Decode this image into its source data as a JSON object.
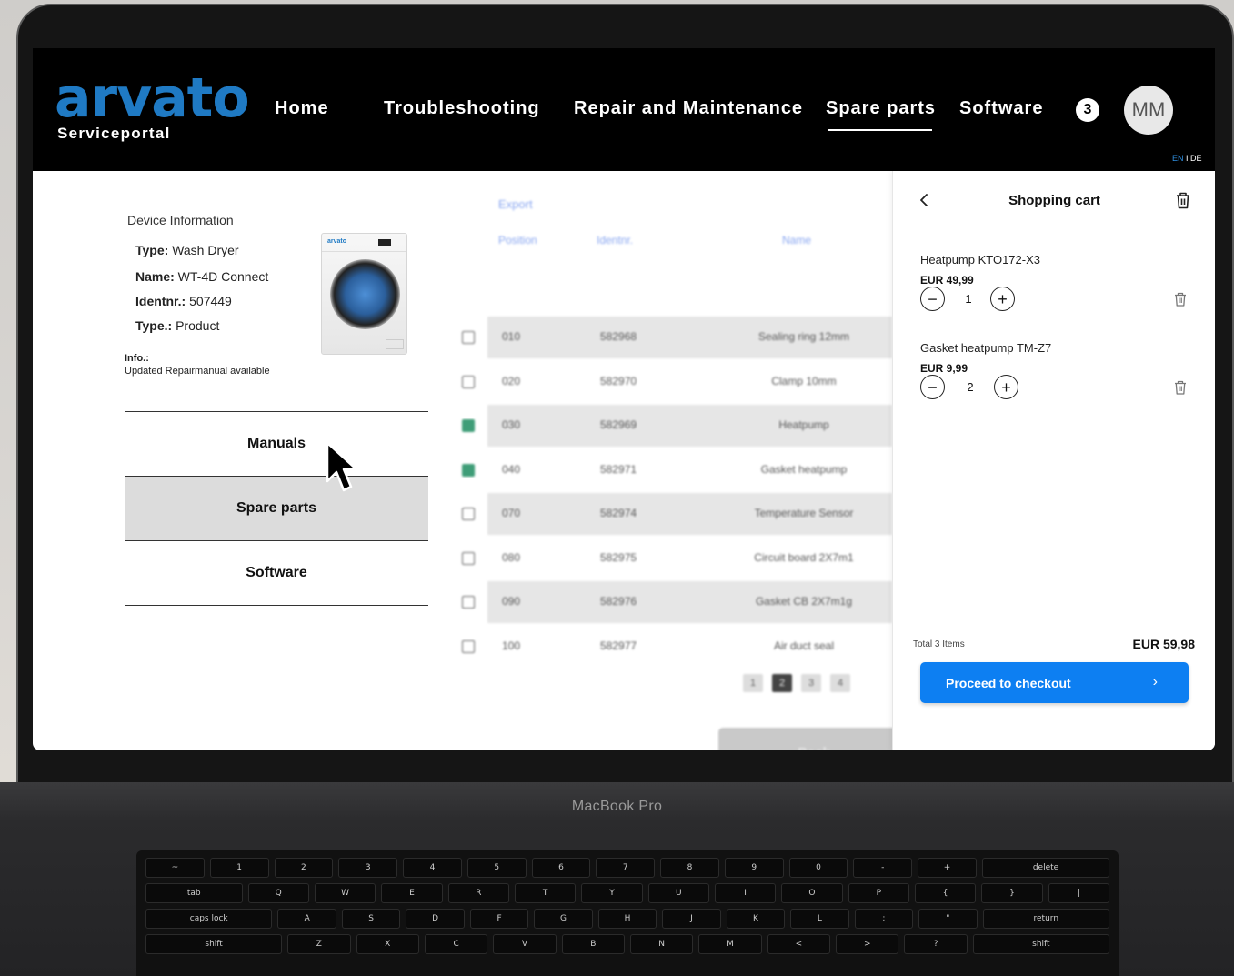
{
  "nav": {
    "logo": "arvato",
    "logo_sub": "Serviceportal",
    "items": [
      "Home",
      "Troubleshooting",
      "Repair and Maintenance",
      "Spare parts",
      "Software"
    ],
    "active": "Spare parts",
    "cart_count": "3",
    "avatar": "MM",
    "lang_en": "EN",
    "lang_sep": " I DE"
  },
  "device": {
    "title": "Device Information",
    "type_label": "Type:",
    "type_value": " Wash Dryer",
    "name_label": "Name:",
    "name_value": " WT-4D Connect",
    "ident_label": "Identnr.:",
    "ident_value": " 507449",
    "type2_label": "Type.:",
    "type2_value": " Product",
    "info_label": "Info.:",
    "info_text": "Updated Repairmanual available",
    "image_brand": "arvato"
  },
  "menu": {
    "items": [
      "Manuals",
      "Spare parts",
      "Software"
    ],
    "active": "Spare parts"
  },
  "parts_table": {
    "export": "Export",
    "headers": [
      "Position",
      "Identnr.",
      "Name"
    ],
    "rows": [
      {
        "position": "010",
        "ident": "582968",
        "name": "Sealing ring 12mm",
        "checked": false
      },
      {
        "position": "020",
        "ident": "582970",
        "name": "Clamp 10mm",
        "checked": false
      },
      {
        "position": "030",
        "ident": "582969",
        "name": "Heatpump",
        "checked": true
      },
      {
        "position": "040",
        "ident": "582971",
        "name": "Gasket heatpump",
        "checked": true
      },
      {
        "position": "070",
        "ident": "582974",
        "name": "Temperature Sensor",
        "checked": false
      },
      {
        "position": "080",
        "ident": "582975",
        "name": "Circuit board 2X7m1",
        "checked": false
      },
      {
        "position": "090",
        "ident": "582976",
        "name": "Gasket CB 2X7m1g",
        "checked": false
      },
      {
        "position": "100",
        "ident": "582977",
        "name": "Air duct seal",
        "checked": false
      }
    ],
    "pages": [
      "1",
      "2",
      "3",
      "4"
    ],
    "current_page": "2",
    "back": "Back"
  },
  "cart": {
    "title": "Shopping cart",
    "items": [
      {
        "name": "Heatpump KTO172-X3",
        "price": "EUR 49,99",
        "qty": "1"
      },
      {
        "name": "Gasket heatpump TM-Z7",
        "price": "EUR 9,99",
        "qty": "2"
      }
    ],
    "total_label": "Total 3 Items",
    "total_value": "EUR 59,98",
    "checkout": "Proceed to checkout"
  },
  "laptop": {
    "model": "MacBook Pro"
  },
  "keyboard": {
    "row1": [
      "~",
      "1",
      "2",
      "3",
      "4",
      "5",
      "6",
      "7",
      "8",
      "9",
      "0",
      "-",
      "+",
      "delete"
    ],
    "row2": [
      "tab",
      "Q",
      "W",
      "E",
      "R",
      "T",
      "Y",
      "U",
      "I",
      "O",
      "P",
      "{",
      "}",
      "|"
    ],
    "row3": [
      "caps lock",
      "A",
      "S",
      "D",
      "F",
      "G",
      "H",
      "J",
      "K",
      "L",
      ";",
      "\"",
      "return"
    ],
    "row4": [
      "shift",
      "Z",
      "X",
      "C",
      "V",
      "B",
      "N",
      "M",
      "<",
      ">",
      "?",
      "shift"
    ]
  },
  "colors": {
    "brand_blue": "#1f7ac4",
    "checkout_blue": "#0d7ff2",
    "checkbox_green": "#3f9d78"
  }
}
